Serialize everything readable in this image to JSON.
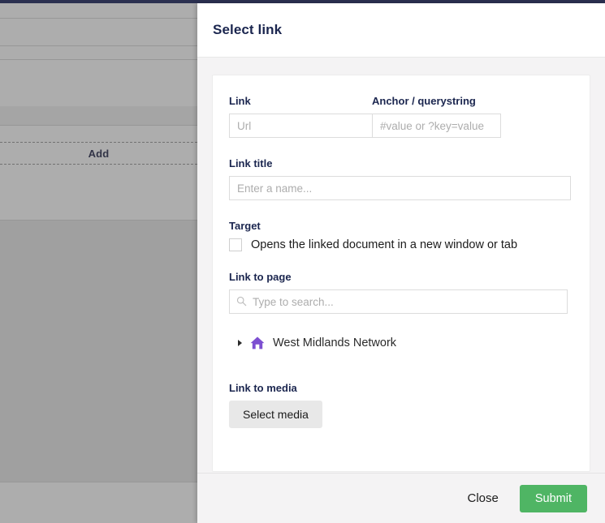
{
  "background": {
    "add_button_label": "Add",
    "topbar_color": "#2b3050",
    "scrim_color": "rgba(60,60,60,0.42)"
  },
  "dialog": {
    "title": "Select link",
    "fields": {
      "link": {
        "label": "Link",
        "placeholder": "Url",
        "value": ""
      },
      "anchor": {
        "label": "Anchor / querystring",
        "placeholder": "#value or ?key=value",
        "value": ""
      },
      "link_title": {
        "label": "Link title",
        "placeholder": "Enter a name...",
        "value": ""
      },
      "target": {
        "label": "Target",
        "checkbox_label": "Opens the linked document in a new window or tab",
        "checked": false
      },
      "link_to_page": {
        "label": "Link to page",
        "placeholder": "Type to search...",
        "value": "",
        "search_icon": "search-icon",
        "tree": [
          {
            "label": "West Midlands Network",
            "icon": "home-icon",
            "icon_color": "#7d4fd1",
            "expanded": false,
            "caret": "caret-right-icon"
          }
        ]
      },
      "link_to_media": {
        "label": "Link to media",
        "button_label": "Select media"
      }
    },
    "footer": {
      "close_label": "Close",
      "submit_label": "Submit",
      "submit_color": "#4fb564"
    }
  }
}
